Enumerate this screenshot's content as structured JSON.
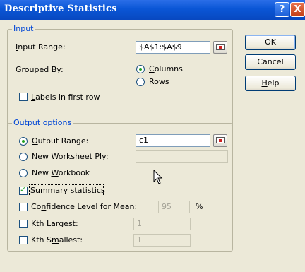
{
  "window": {
    "title": "Descriptive Statistics"
  },
  "title_buttons": {
    "help": "?",
    "close": "X"
  },
  "input_group": {
    "legend": "Input",
    "input_range": {
      "label_pre": "",
      "label_u": "I",
      "label_post": "nput Range:",
      "value": "$A$1:$A$9"
    },
    "grouped_by": {
      "label": "Grouped By:"
    },
    "columns": {
      "label_pre": "",
      "label_u": "C",
      "label_post": "olumns",
      "selected": true
    },
    "rows": {
      "label_pre": "",
      "label_u": "R",
      "label_post": "ows",
      "selected": false
    },
    "labels_first_row": {
      "label_pre": "",
      "label_u": "L",
      "label_post": "abels in first row",
      "checked": false
    }
  },
  "output_group": {
    "legend": "Output options",
    "output_range": {
      "label_pre": "",
      "label_u": "O",
      "label_post": "utput Range:",
      "value": "c1",
      "selected": true
    },
    "new_worksheet": {
      "label_pre": "New Worksheet ",
      "label_u": "P",
      "label_post": "ly:",
      "value": "",
      "selected": false
    },
    "new_workbook": {
      "label_pre": "New ",
      "label_u": "W",
      "label_post": "orkbook",
      "selected": false
    },
    "summary_stats": {
      "label_pre": "",
      "label_u": "S",
      "label_post": "ummary statistics",
      "checked": true
    },
    "confidence": {
      "label_pre": "Co",
      "label_u": "n",
      "label_post": "fidence Level for Mean:",
      "value": "95",
      "unit": "%",
      "checked": false
    },
    "kth_largest": {
      "label_pre": "Kth L",
      "label_u": "a",
      "label_post": "rgest:",
      "value": "1",
      "checked": false
    },
    "kth_smallest": {
      "label_pre": "Kth S",
      "label_u": "m",
      "label_post": "allest:",
      "value": "1",
      "checked": false
    }
  },
  "buttons": {
    "ok": "OK",
    "cancel": "Cancel",
    "help_pre": "",
    "help_u": "H",
    "help_post": "elp"
  },
  "icons": {
    "ref_button": "range-selector-icon",
    "cursor": "mouse-pointer-icon"
  }
}
